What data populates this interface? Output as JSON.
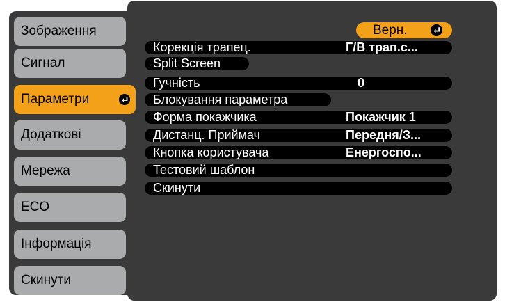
{
  "sidebar": {
    "items": [
      {
        "label": "Зображення"
      },
      {
        "label": "Сигнал"
      },
      {
        "label": "Параметри"
      },
      {
        "label": "Додаткові"
      },
      {
        "label": "Мережа"
      },
      {
        "label": "ECO"
      },
      {
        "label": "Інформація"
      },
      {
        "label": "Скинути"
      }
    ]
  },
  "main": {
    "return_label": "Верн.",
    "rows": [
      {
        "label": "Корекція трапец.",
        "value": "Г/В трап.с..."
      },
      {
        "label": "Split Screen",
        "value": ""
      },
      {
        "label": "Гучність",
        "value": "0"
      },
      {
        "label": "Блокування параметра",
        "value": ""
      },
      {
        "label": "Форма покажчика",
        "value": "Покажчик 1"
      },
      {
        "label": "Дистанц. Приймач",
        "value": "Передня/З..."
      },
      {
        "label": "Кнопка користувача",
        "value": "Енергоспо..."
      },
      {
        "label": "Тестовий шаблон",
        "value": ""
      },
      {
        "label": "Скинути",
        "value": ""
      }
    ]
  },
  "colors": {
    "accent": "#f4a11a",
    "tab": "#a9abad",
    "panel": "#3a3a3a",
    "row": "#000000"
  },
  "icons": {
    "enter": "enter-icon"
  }
}
